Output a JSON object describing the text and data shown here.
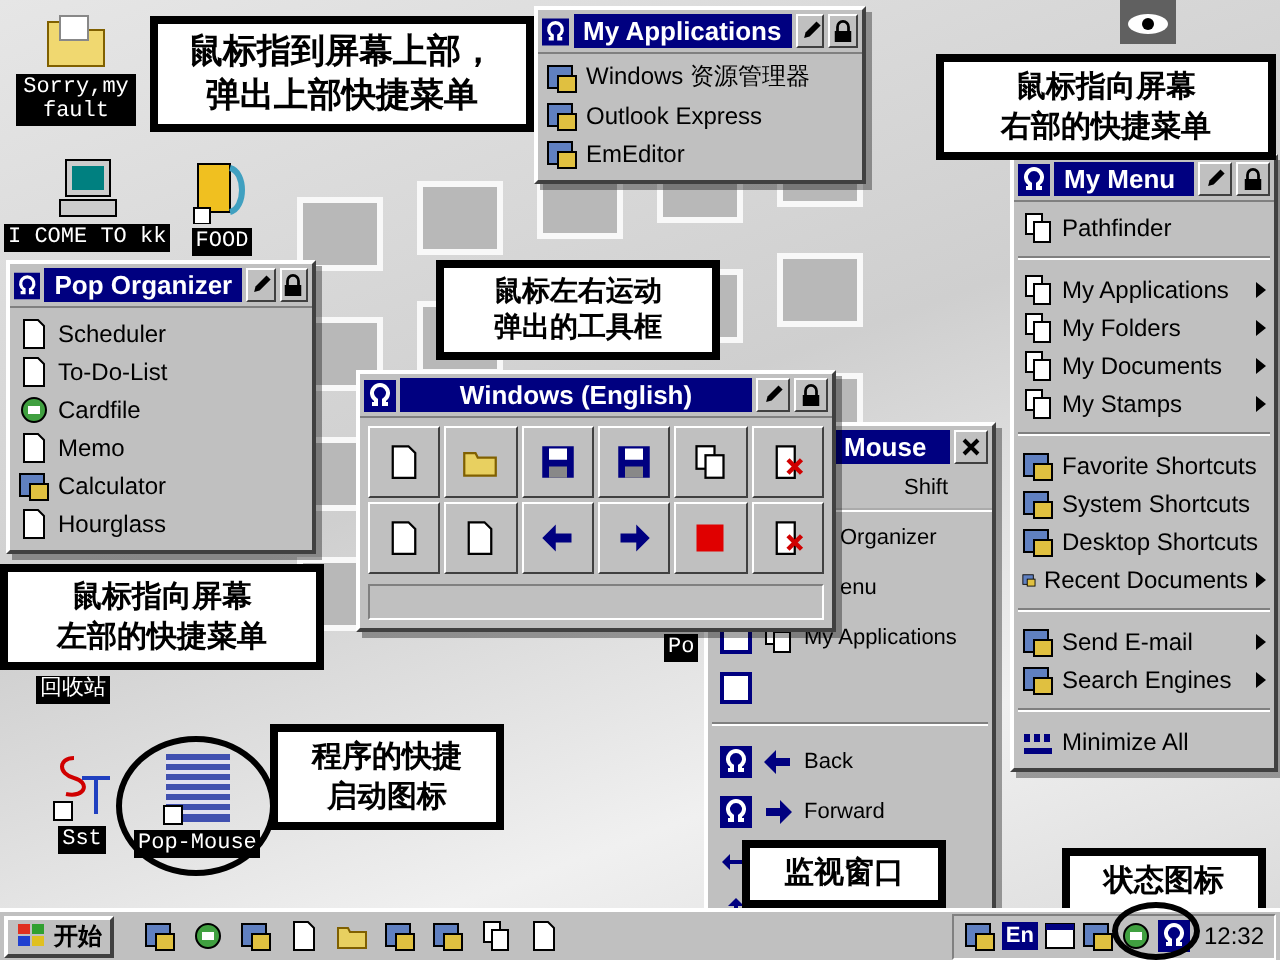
{
  "desktop_icons": [
    {
      "kind": "folder",
      "label": "Sorry,my fault"
    },
    {
      "kind": "computer",
      "label": "I COME TO kk"
    },
    {
      "kind": "cabinet",
      "label": "FOOD"
    },
    {
      "kind": "none",
      "label": "回收站"
    },
    {
      "kind": "sst",
      "label": "Sst"
    },
    {
      "kind": "popmouse",
      "label": "Pop-Mouse"
    },
    {
      "kind": "none",
      "label": "Po"
    }
  ],
  "callouts": [
    {
      "lines": [
        "鼠标指到屏幕上部，",
        "弹出上部快捷菜单"
      ]
    },
    {
      "lines": [
        "鼠标指向屏幕",
        "右部的快捷菜单"
      ]
    },
    {
      "lines": [
        "鼠标左右运动",
        "弹出的工具框"
      ]
    },
    {
      "lines": [
        "鼠标指向屏幕",
        "左部的快捷菜单"
      ]
    },
    {
      "lines": [
        "程序的快捷",
        "启动图标"
      ]
    },
    {
      "lines": [
        "监视窗口"
      ]
    },
    {
      "lines": [
        "状态图标"
      ]
    }
  ],
  "app_menu": {
    "title": "My Applications",
    "items": [
      "Windows 资源管理器",
      "Outlook Express",
      "EmEditor"
    ]
  },
  "my_menu": {
    "title": "My Menu",
    "items": [
      {
        "kind": "item",
        "label": "Pathfinder",
        "submenu": false
      },
      {
        "kind": "separator"
      },
      {
        "kind": "item",
        "label": "My Applications",
        "submenu": true
      },
      {
        "kind": "item",
        "label": "My Folders",
        "submenu": true
      },
      {
        "kind": "item",
        "label": "My Documents",
        "submenu": true
      },
      {
        "kind": "item",
        "label": "My Stamps",
        "submenu": true
      },
      {
        "kind": "separator"
      },
      {
        "kind": "item",
        "label": "Favorite Shortcuts",
        "submenu": false
      },
      {
        "kind": "item",
        "label": "System Shortcuts",
        "submenu": false
      },
      {
        "kind": "item",
        "label": "Desktop Shortcuts",
        "submenu": false
      },
      {
        "kind": "item",
        "label": "Recent Documents",
        "submenu": true
      },
      {
        "kind": "separator"
      },
      {
        "kind": "item",
        "label": "Send E-mail",
        "submenu": true
      },
      {
        "kind": "item",
        "label": "Search Engines",
        "submenu": true
      },
      {
        "kind": "separator"
      },
      {
        "kind": "item",
        "label": "Minimize All",
        "submenu": false
      }
    ]
  },
  "organizer": {
    "title": "Pop Organizer",
    "items": [
      "Scheduler",
      "To-Do-List",
      "Cardfile",
      "Memo",
      "Calculator",
      "Hourglass"
    ]
  },
  "toolbar": {
    "title": "Windows (English)"
  },
  "monitor": {
    "title": "Mouse",
    "header": "Shift",
    "rows": [
      {
        "kind": "covered",
        "label": "Organizer"
      },
      {
        "kind": "covered",
        "label": "enu"
      },
      {
        "kind": "window",
        "label": "My Applications"
      },
      {
        "kind": "blank"
      },
      {
        "kind": "separator"
      },
      {
        "kind": "back",
        "label": "Back"
      },
      {
        "kind": "forward",
        "label": "Forward"
      },
      {
        "kind": "resize_h"
      },
      {
        "kind": "resize_v"
      }
    ]
  },
  "taskbar": {
    "start": "开始",
    "language": "En",
    "clock": "12:32"
  }
}
